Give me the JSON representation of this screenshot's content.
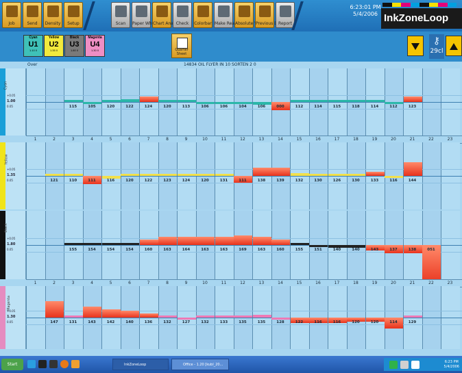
{
  "toolbar": {
    "buttons": [
      {
        "label": "Job",
        "icon": "folder-icon",
        "kind": "gold"
      },
      {
        "label": "Send",
        "icon": "send-icon",
        "kind": "gold"
      },
      {
        "label": "Density",
        "icon": "density-icon",
        "kind": "gold"
      },
      {
        "label": "Setup",
        "icon": "setup-icon",
        "kind": "gold"
      },
      {
        "label": "Scan",
        "icon": "scan-icon",
        "kind": "grey"
      },
      {
        "label": "Paper White",
        "icon": "paper-icon",
        "kind": "grey"
      },
      {
        "label": "Chart Analysis",
        "icon": "chart-icon",
        "kind": "gold"
      },
      {
        "label": "Check",
        "icon": "check-icon",
        "kind": "grey"
      },
      {
        "label": "Colorbar",
        "icon": "colorbar-icon",
        "kind": "gold"
      },
      {
        "label": "Make Ready",
        "icon": "make-ready-icon",
        "kind": "grey"
      },
      {
        "label": "Absolute Values",
        "icon": "absolute-icon",
        "kind": "gold"
      },
      {
        "label": "Previous Densities",
        "icon": "previous-icon",
        "kind": "gold"
      },
      {
        "label": "Report",
        "icon": "report-icon",
        "kind": "grey"
      }
    ],
    "clock_time": "6:23:01 PM",
    "clock_date": "5/4/2006",
    "brand": "InkZoneLoop"
  },
  "units": [
    {
      "name": "Cyan",
      "code": "U1",
      "sub": "1.10 0",
      "color": "#3fc1b8"
    },
    {
      "name": "Yellow",
      "code": "U2",
      "sub": "1.35 0",
      "color": "#f3ea3c"
    },
    {
      "name": "Black",
      "code": "U3",
      "sub": "1.80 0",
      "color": "#7a7a7a"
    },
    {
      "name": "Magenta",
      "code": "U4",
      "sub": "1.30 0",
      "color": "#ef8ec4"
    }
  ],
  "quarter_label": "Quarter Sheet",
  "key_value": "29",
  "key_unit": "cl",
  "grid": {
    "mode": "Over",
    "job_title": "14834 OIL FLYER IN 10 SORTEN 2 0"
  },
  "zone_numbers": [
    "1",
    "2",
    "3",
    "4",
    "5",
    "6",
    "7",
    "8",
    "9",
    "10",
    "11",
    "12",
    "13",
    "14",
    "15",
    "16",
    "17",
    "18",
    "19",
    "20",
    "21",
    "22",
    "23"
  ],
  "sections": [
    {
      "name": "Cyan",
      "color": "#1a9fd8",
      "bar_color": "#2bb7a9",
      "ref": "1.00",
      "upper": "+0.05",
      "lower": "0.05",
      "values": [
        "",
        "",
        "115",
        "105",
        "120",
        "122",
        "124",
        "120",
        "113",
        "106",
        "106",
        "104",
        "106",
        "000",
        "112",
        "114",
        "115",
        "118",
        "114",
        "112",
        "123",
        "",
        ""
      ],
      "deviation": [
        0,
        0,
        0,
        -1,
        1,
        2,
        4,
        0,
        0,
        -1,
        -1,
        -1,
        -2,
        -6,
        0,
        0,
        0,
        1,
        0,
        -1,
        4,
        0,
        0
      ]
    },
    {
      "name": "Yellow",
      "color": "#f0e41a",
      "bar_color": "#f2e04a",
      "ref": "1.35",
      "upper": "+0.05",
      "lower": "0.05",
      "values": [
        "",
        "121",
        "110",
        "111",
        "116",
        "120",
        "122",
        "123",
        "124",
        "120",
        "131",
        "111",
        "138",
        "139",
        "132",
        "130",
        "126",
        "130",
        "133",
        "116",
        "144",
        "",
        ""
      ],
      "deviation": [
        0,
        0,
        0,
        -6,
        -2,
        0,
        0,
        0,
        0,
        1,
        1,
        -5,
        6,
        6,
        2,
        0,
        0,
        1,
        3,
        -1,
        10,
        0,
        0
      ]
    },
    {
      "name": "Black",
      "color": "#111111",
      "bar_color": "#222222",
      "ref": "1.80",
      "upper": "+0.05",
      "lower": "0.05",
      "values": [
        "",
        "",
        "155",
        "154",
        "154",
        "154",
        "160",
        "163",
        "164",
        "163",
        "163",
        "169",
        "163",
        "160",
        "155",
        "151",
        "140",
        "140",
        "143",
        "137",
        "138",
        "051",
        "",
        ""
      ],
      "deviation": [
        0,
        0,
        0,
        0,
        0,
        0,
        4,
        6,
        6,
        6,
        6,
        7,
        6,
        4,
        0,
        -1,
        -2,
        -2,
        -4,
        -6,
        -6,
        -30,
        0
      ]
    },
    {
      "name": "Magenta",
      "color": "#e58cc0",
      "bar_color": "#ee79b5",
      "ref": "1.30",
      "upper": "+0.05",
      "lower": "0.05",
      "values": [
        "",
        "147",
        "131",
        "143",
        "142",
        "140",
        "136",
        "132",
        "127",
        "132",
        "133",
        "135",
        "135",
        "128",
        "122",
        "116",
        "116",
        "120",
        "120",
        "114",
        "129",
        "",
        ""
      ],
      "deviation": [
        0,
        12,
        0,
        8,
        6,
        5,
        3,
        0,
        -1,
        0,
        0,
        1,
        2,
        -1,
        -4,
        -4,
        -4,
        -3,
        -3,
        -8,
        0,
        0,
        0
      ]
    }
  ],
  "taskbar": {
    "start": "Start",
    "tasks": [
      "InkZoneLoop",
      "Office - 1.20 [kubl_20..."
    ],
    "tray_time": "6:23 PM",
    "tray_date": "5/4/2006"
  }
}
